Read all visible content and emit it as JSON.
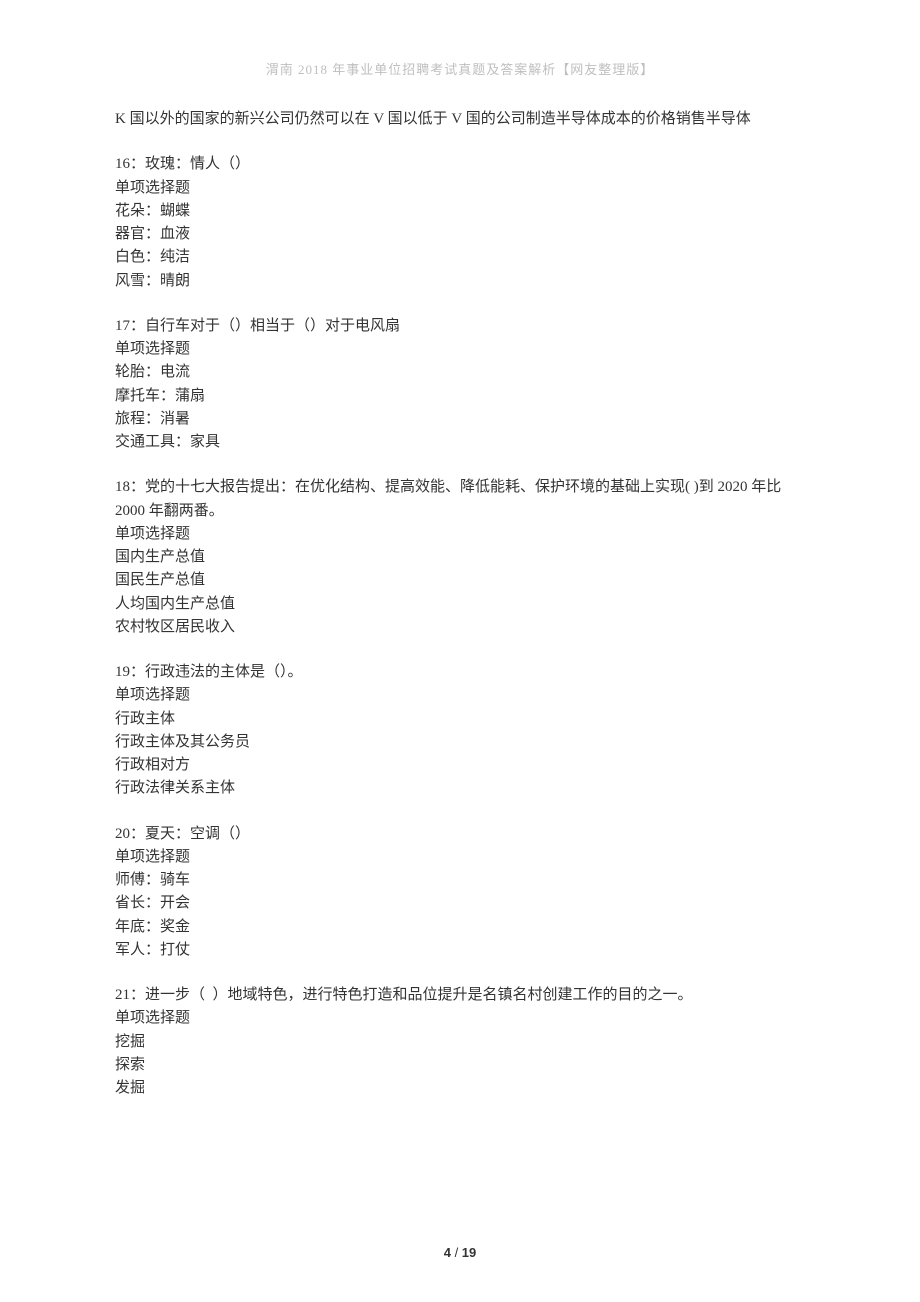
{
  "header": "渭南 2018 年事业单位招聘考试真题及答案解析【网友整理版】",
  "leadIn": "K 国以外的国家的新兴公司仍然可以在 V 国以低于 V 国的公司制造半导体成本的价格销售半导体",
  "questions": [
    {
      "stem": "16：玫瑰：情人（）",
      "type": "单项选择题",
      "options": [
        "花朵：蝴蝶",
        "器官：血液",
        "白色：纯洁",
        "风雪：晴朗"
      ]
    },
    {
      "stem": "17：自行车对于（）相当于（）对于电风扇",
      "type": "单项选择题",
      "options": [
        "轮胎：电流",
        "摩托车：蒲扇",
        "旅程：消暑",
        "交通工具：家具"
      ]
    },
    {
      "stem": "18：党的十七大报告提出：在优化结构、提高效能、降低能耗、保护环境的基础上实现( )到 2020 年比 2000 年翻两番。",
      "type": "单项选择题",
      "options": [
        "国内生产总值",
        "国民生产总值",
        "人均国内生产总值",
        "农村牧区居民收入"
      ]
    },
    {
      "stem": "19：行政违法的主体是（）。",
      "type": "单项选择题",
      "options": [
        "行政主体",
        "行政主体及其公务员",
        "行政相对方",
        "行政法律关系主体"
      ]
    },
    {
      "stem": "20：夏天：空调（）",
      "type": "单项选择题",
      "options": [
        "师傅：骑车",
        "省长：开会",
        "年底：奖金",
        "军人：打仗"
      ]
    },
    {
      "stem": "21：进一步（  ）地域特色，进行特色打造和品位提升是名镇名村创建工作的目的之一。",
      "type": "单项选择题",
      "options": [
        "挖掘",
        "探索",
        "发掘"
      ]
    }
  ],
  "footer": {
    "current": "4",
    "sep": " / ",
    "total": "19"
  }
}
